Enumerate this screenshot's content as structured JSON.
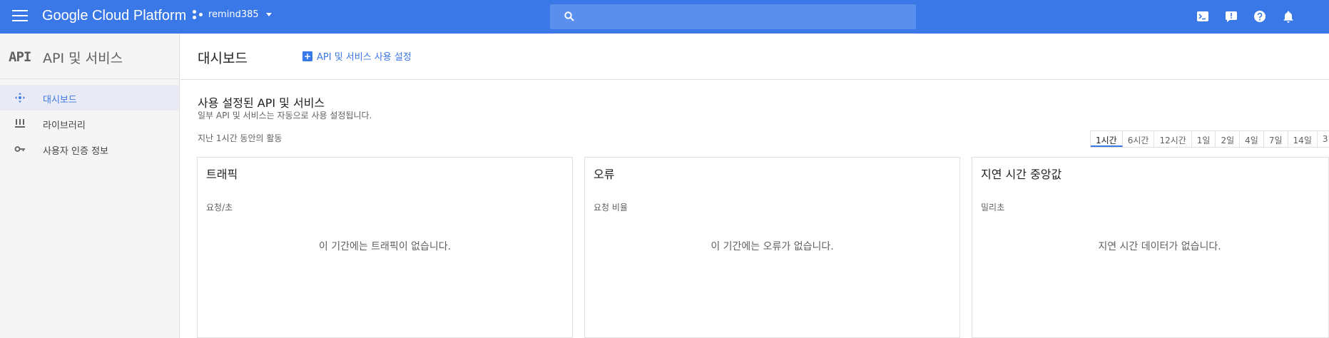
{
  "topbar": {
    "logo": "Google Cloud Platform",
    "project": "remind385",
    "search_placeholder": "",
    "bg_color": "#3b78e7",
    "icons": [
      "menu-icon",
      "search-icon",
      "cloud-shell-icon",
      "feedback-icon",
      "help-icon",
      "notifications-icon"
    ]
  },
  "sidebar": {
    "logo_text": "API",
    "title": "API 및 서비스",
    "items": [
      {
        "label": "대시보드",
        "icon": "dashboard-icon",
        "active": true
      },
      {
        "label": "라이브러리",
        "icon": "library-icon",
        "active": false
      },
      {
        "label": "사용자 인증 정보",
        "icon": "key-icon",
        "active": false
      }
    ]
  },
  "main": {
    "title": "대시보드",
    "enable_button": "API 및 서비스 사용 설정",
    "section_title": "사용 설정된 API 및 서비스",
    "section_subtitle": "일부 API 및 서비스는 자동으로 사용 설정됩니다.",
    "activity_label": "지난 1시간 동안의 활동",
    "time_ranges": [
      "1시간",
      "6시간",
      "12시간",
      "1일",
      "2일",
      "4일",
      "7일",
      "14일",
      "3"
    ],
    "selected_range": "1시간",
    "cards": [
      {
        "title": "트래픽",
        "unit": "요청/초",
        "empty": "이 기간에는 트래픽이 없습니다."
      },
      {
        "title": "오류",
        "unit": "요청 비율",
        "empty": "이 기간에는 오류가 없습니다."
      },
      {
        "title": "지연 시간 중앙값",
        "unit": "밀리초",
        "empty": "지연 시간 데이터가 없습니다."
      }
    ]
  }
}
